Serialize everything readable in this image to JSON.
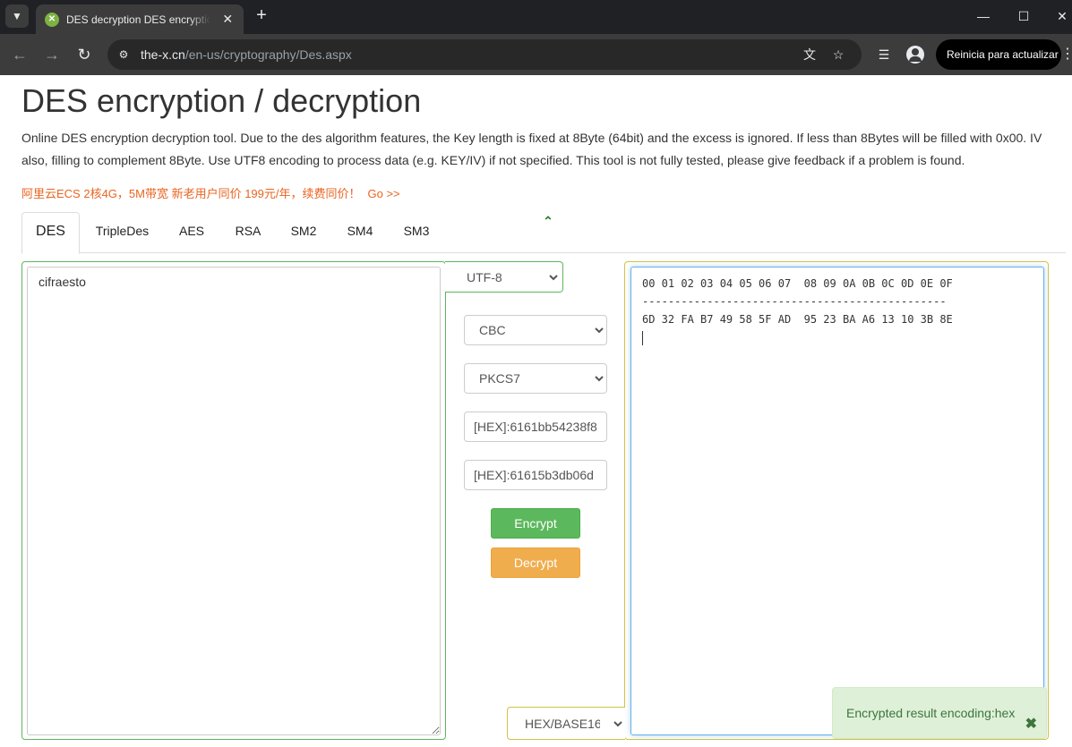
{
  "browser": {
    "tab_title": "DES decryption DES encryption",
    "url_host": "the-x.cn",
    "url_path": "/en-us/cryptography/Des.aspx",
    "update_button": "Reinicia para actualizar",
    "icons": [
      "tab-search-icon",
      "favicon-icon",
      "close-icon",
      "new-tab-icon",
      "minimize-icon",
      "maximize-icon",
      "window-close-icon",
      "back-icon",
      "forward-icon",
      "reload-icon",
      "site-info-icon",
      "translate-icon",
      "bookmark-star-icon",
      "media-controls-icon",
      "profile-icon",
      "menu-icon"
    ]
  },
  "page": {
    "title": "DES encryption / decryption",
    "description": "Online DES encryption decryption tool. Due to the des algorithm features, the Key length is fixed at 8Byte (64bit) and the excess is ignored. If less than 8Bytes will be filled with 0x00. IV also, filling to complement 8Byte. Use UTF8 encoding to process data (e.g. KEY/IV) if not specified. This tool is not fully tested, please give feedback if a problem is found.",
    "promo_text": "阿里云ECS 2核4G，5M带宽 新老用户同价 199元/年，续费同价！",
    "promo_link": "Go >>"
  },
  "tabs": [
    {
      "label": "DES",
      "active": true
    },
    {
      "label": "TripleDes"
    },
    {
      "label": "AES"
    },
    {
      "label": "RSA"
    },
    {
      "label": "SM2"
    },
    {
      "label": "SM4"
    },
    {
      "label": "SM3"
    }
  ],
  "form": {
    "input_text": "cifraesto",
    "charset": "UTF-8",
    "mode": "CBC",
    "padding": "PKCS7",
    "key": "[HEX]:6161bb54238f8",
    "iv": "[HEX]:61615b3db06d",
    "encrypt_label": "Encrypt",
    "decrypt_label": "Decrypt",
    "output_encoding": "HEX/BASE16"
  },
  "output": {
    "header": "00 01 02 03 04 05 06 07  08 09 0A 0B 0C 0D 0E 0F",
    "separator": "-----------------------------------------------",
    "row": "6D 32 FA B7 49 58 5F AD  95 23 BA A6 13 10 3B 8E"
  },
  "toast": {
    "message": "Encrypted result encoding:hex"
  }
}
